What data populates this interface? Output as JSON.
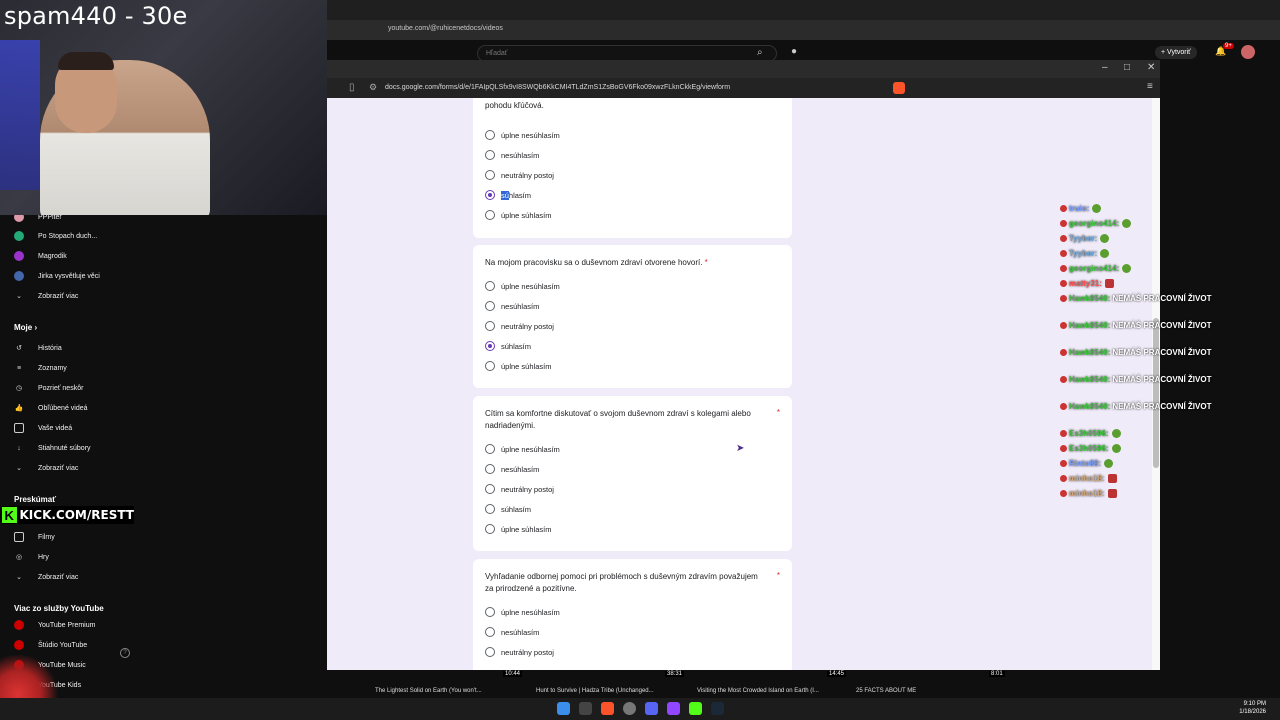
{
  "webcam": {
    "title": "spam440 - 30e"
  },
  "youtube": {
    "url": "youtube.com/@ruhicenetdocs/videos",
    "search_placeholder": "Hľadať",
    "create_label": "Vytvoriť",
    "notifications": "9+"
  },
  "sidebar": {
    "subs_partial": "PPPiter",
    "subs": [
      "Po Stopach duch...",
      "Magrodik",
      "Jirka vysvětluje věci"
    ],
    "show_more": "Zobraziť viac",
    "moje_header": "Moje",
    "moje": [
      "História",
      "Zoznamy",
      "Pozrieť neskôr",
      "Obľúbené videá",
      "Vaše videá",
      "Stiahnuté súbory",
      "Zobraziť viac"
    ],
    "explore_header": "Preskúmať",
    "kick_text": "KICK.COM/RESTT",
    "explore": [
      "Filmy",
      "Hry",
      "Zobraziť viac"
    ],
    "more_header": "Viac zo služby YouTube",
    "more": [
      "YouTube Premium",
      "Štúdio YouTube",
      "YouTube Music",
      "YouTube Kids"
    ]
  },
  "docs": {
    "url": "docs.google.com/forms/d/e/1FAIpQLSfx9vI8SWQb6KkCMI4TLdZmS1ZsBoGV6Fko09xwzFLknCkkEg/viewform",
    "questions": [
      {
        "text": "Rovnováha medzi pracovným a osobným životom je pre moju psychickú pohodu kľúčová.",
        "options": [
          "úplne nesúhlasím",
          "nesúhlasím",
          "neutrálny postoj",
          "súhlasím",
          "úplne súhlasím"
        ],
        "selected_highlight_prefix": "sú",
        "selected_rest": "hlasím"
      },
      {
        "text": "Na mojom pracovisku sa o duševnom zdraví otvorene hovorí.",
        "options": [
          "úplne nesúhlasím",
          "nesúhlasím",
          "neutrálny postoj",
          "súhlasím",
          "úplne súhlasím"
        ]
      },
      {
        "text": "Cítim sa komfortne diskutovať o svojom duševnom zdraví s kolegami alebo nadriadenými.",
        "options": [
          "úplne nesúhlasím",
          "nesúhlasím",
          "neutrálny postoj",
          "súhlasím",
          "úplne súhlasím"
        ]
      },
      {
        "text": "Vyhľadanie odbornej pomoci pri problémoch s duševným zdravím považujem za prirodzené a pozitívne.",
        "options": [
          "úplne nesúhlasím",
          "nesúhlasím",
          "neutrálny postoj"
        ]
      }
    ],
    "required_mark": "*"
  },
  "chat": [
    {
      "user": "truio:",
      "color": "#7aa0ff",
      "msg": ""
    },
    {
      "user": "georgino414:",
      "color": "#3fbf3f",
      "msg": ""
    },
    {
      "user": "Tyyber:",
      "color": "#6fa8dc",
      "msg": ""
    },
    {
      "user": "Tyyber:",
      "color": "#6fa8dc",
      "msg": ""
    },
    {
      "user": "georgino414:",
      "color": "#3fbf3f",
      "msg": ""
    },
    {
      "user": "matty31:",
      "color": "#ff4e4e",
      "msg": ""
    },
    {
      "user": "Hawk8540:",
      "color": "#3fbf3f",
      "msg": "NEMÁŠ PRACOVNÍ ŽIVOT"
    },
    {
      "user": "Hawk8540:",
      "color": "#3fbf3f",
      "msg": "NEMÁŠ PRACOVNÍ ŽIVOT"
    },
    {
      "user": "Hawk8540:",
      "color": "#3fbf3f",
      "msg": "NEMÁŠ PRACOVNÍ ŽIVOT"
    },
    {
      "user": "Hawk8540:",
      "color": "#3fbf3f",
      "msg": "NEMÁŠ PRACOVNÍ ŽIVOT"
    },
    {
      "user": "Hawk8540:",
      "color": "#3fbf3f",
      "msg": "NEMÁŠ PRACOVNÍ ŽIVOT"
    },
    {
      "user": "Es3h0596:",
      "color": "#3fbf3f",
      "msg": ""
    },
    {
      "user": "Es3h0596:",
      "color": "#3fbf3f",
      "msg": ""
    },
    {
      "user": "Rinto88:",
      "color": "#7aa0ff",
      "msg": ""
    },
    {
      "user": "minho18:",
      "color": "#d2a679",
      "msg": ""
    },
    {
      "user": "minho18:",
      "color": "#d2a679",
      "msg": ""
    }
  ],
  "thumbnails": [
    {
      "title": "The Lightest Solid on Earth (You won't...",
      "duration": "10:44"
    },
    {
      "title": "Hunt to Survive | Hadza Tribe (Unchanged...",
      "duration": "38:31"
    },
    {
      "title": "Visiting the Most Crowded Island on Earth (I...",
      "duration": "14:45"
    },
    {
      "title": "25 FACTS ABOUT ME",
      "duration": "8:01"
    }
  ],
  "clock": {
    "time": "9:10 PM",
    "date": "1/18/2026"
  }
}
